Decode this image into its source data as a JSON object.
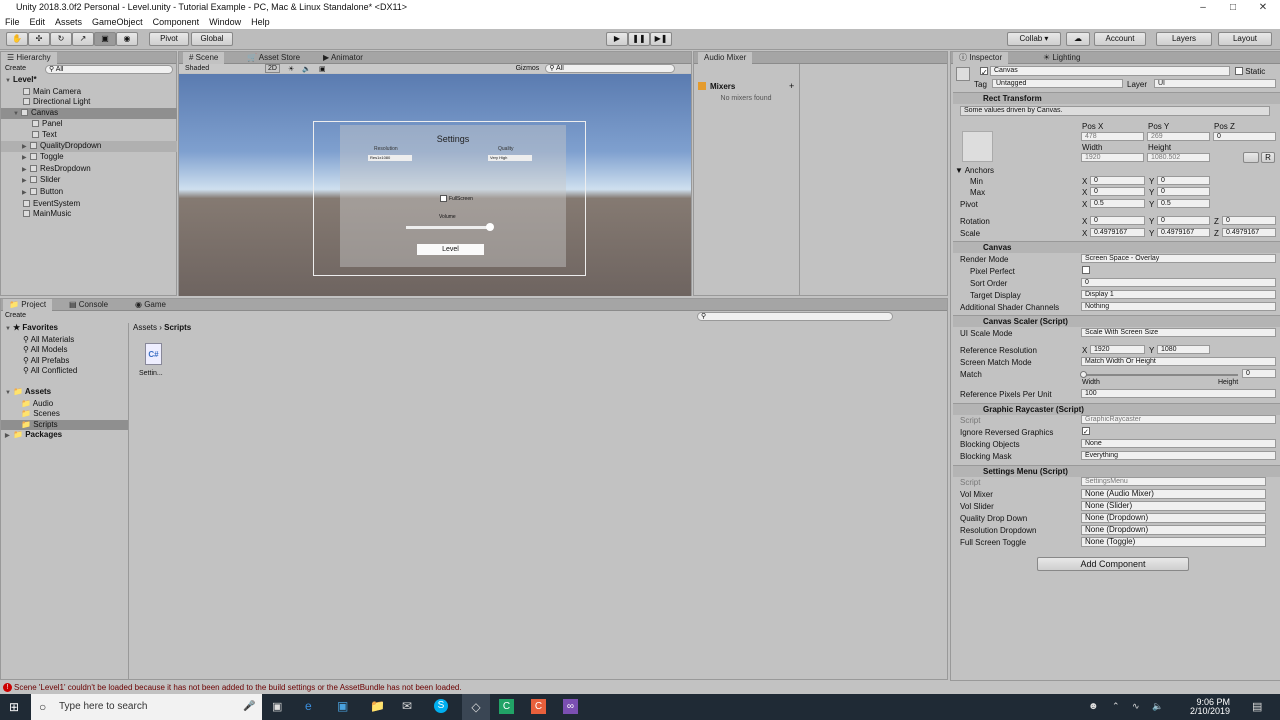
{
  "window": {
    "title": "Unity 2018.3.0f2 Personal - Level.unity - Tutorial Example - PC, Mac & Linux Standalone* <DX11>"
  },
  "menu": [
    "File",
    "Edit",
    "Assets",
    "GameObject",
    "Component",
    "Window",
    "Help"
  ],
  "toolbar": {
    "pivot": "Pivot",
    "global": "Global",
    "collab": "Collab ▾",
    "account": "Account",
    "layers": "Layers",
    "layout": "Layout"
  },
  "hierarchy": {
    "tab": "Hierarchy",
    "create": "Create",
    "search": "All",
    "scene": "Level*",
    "items": [
      "Main Camera",
      "Directional Light",
      "Canvas",
      "Panel",
      "Text",
      "QualityDropdown",
      "Toggle",
      "ResDropdown",
      "Slider",
      "Button",
      "EventSystem",
      "MainMusic"
    ]
  },
  "scene": {
    "tabs": [
      "Scene",
      "Asset Store",
      "Animator"
    ],
    "shading": "Shaded",
    "mode2d": "2D",
    "gizmos": "Gizmos",
    "search": "All",
    "ui": {
      "title": "Settings",
      "resolution": "Resolution",
      "quality": "Quality",
      "res_value": "Res1x1080",
      "quality_value": "Very High",
      "fullscreen": "FullScreen",
      "volume": "Volume",
      "level": "Level"
    }
  },
  "audio_mixer": {
    "tab": "Audio Mixer",
    "mixers": "Mixers",
    "none": "No mixers found"
  },
  "project": {
    "tabs": [
      "Project",
      "Console",
      "Game"
    ],
    "create": "Create",
    "favorites": "Favorites",
    "fav_items": [
      "All Materials",
      "All Models",
      "All Prefabs",
      "All Conflicted"
    ],
    "assets": "Assets",
    "asset_items": [
      "Audio",
      "Scenes",
      "Scripts"
    ],
    "packages": "Packages",
    "breadcrumb": [
      "Assets",
      "Scripts"
    ],
    "file": "Settin..."
  },
  "inspector": {
    "tabs": [
      "Inspector",
      "Lighting"
    ],
    "name": "Canvas",
    "static": "Static",
    "tag_label": "Tag",
    "tag": "Untagged",
    "layer_label": "Layer",
    "layer": "UI",
    "rect": {
      "title": "Rect Transform",
      "note": "Some values driven by Canvas.",
      "posx_label": "Pos X",
      "posy_label": "Pos Y",
      "posz_label": "Pos Z",
      "posx": "478",
      "posy": "269",
      "posz": "0",
      "width_label": "Width",
      "height_label": "Height",
      "width": "1920",
      "height": "1080.502",
      "anchors": "Anchors",
      "min": "Min",
      "max": "Max",
      "min_x": "0",
      "min_y": "0",
      "max_x": "0",
      "max_y": "0",
      "pivot": "Pivot",
      "pivot_x": "0.5",
      "pivot_y": "0.5",
      "rotation": "Rotation",
      "rot_x": "0",
      "rot_y": "0",
      "rot_z": "0",
      "scale": "Scale",
      "scale_x": "0.4979167",
      "scale_y": "0.4979167",
      "scale_z": "0.4979167"
    },
    "canvas": {
      "title": "Canvas",
      "render_mode_label": "Render Mode",
      "render_mode": "Screen Space - Overlay",
      "pixel_perfect": "Pixel Perfect",
      "sort_order_label": "Sort Order",
      "sort_order": "0",
      "target_display_label": "Target Display",
      "target_display": "Display 1",
      "shader_channels_label": "Additional Shader Channels",
      "shader_channels": "Nothing"
    },
    "scaler": {
      "title": "Canvas Scaler (Script)",
      "ui_scale_label": "UI Scale Mode",
      "ui_scale": "Scale With Screen Size",
      "ref_res_label": "Reference Resolution",
      "ref_x": "1920",
      "ref_y": "1080",
      "match_mode_label": "Screen Match Mode",
      "match_mode": "Match Width Or Height",
      "match_label": "Match",
      "match_value": "0",
      "width": "Width",
      "height": "Height",
      "ppu_label": "Reference Pixels Per Unit",
      "ppu": "100"
    },
    "raycaster": {
      "title": "Graphic Raycaster (Script)",
      "script_label": "Script",
      "script": "GraphicRaycaster",
      "ignore_label": "Ignore Reversed Graphics",
      "blocking_obj_label": "Blocking Objects",
      "blocking_obj": "None",
      "blocking_mask_label": "Blocking Mask",
      "blocking_mask": "Everything"
    },
    "settings": {
      "title": "Settings Menu (Script)",
      "script_label": "Script",
      "script": "SettingsMenu",
      "vol_mixer_label": "Vol Mixer",
      "vol_mixer": "None (Audio Mixer)",
      "vol_slider_label": "Vol Slider",
      "vol_slider": "None (Slider)",
      "qdd_label": "Quality Drop Down",
      "qdd": "None (Dropdown)",
      "rdd_label": "Resolution Dropdown",
      "rdd": "None (Dropdown)",
      "fst_label": "Full Screen Toggle",
      "fst": "None (Toggle)"
    },
    "add_component": "Add Component"
  },
  "status": "Scene 'Level1' couldn't be loaded because it has not been added to the build settings or the AssetBundle has not been loaded.",
  "taskbar": {
    "search": "Type here to search",
    "time": "9:06 PM",
    "date": "2/10/2019"
  }
}
